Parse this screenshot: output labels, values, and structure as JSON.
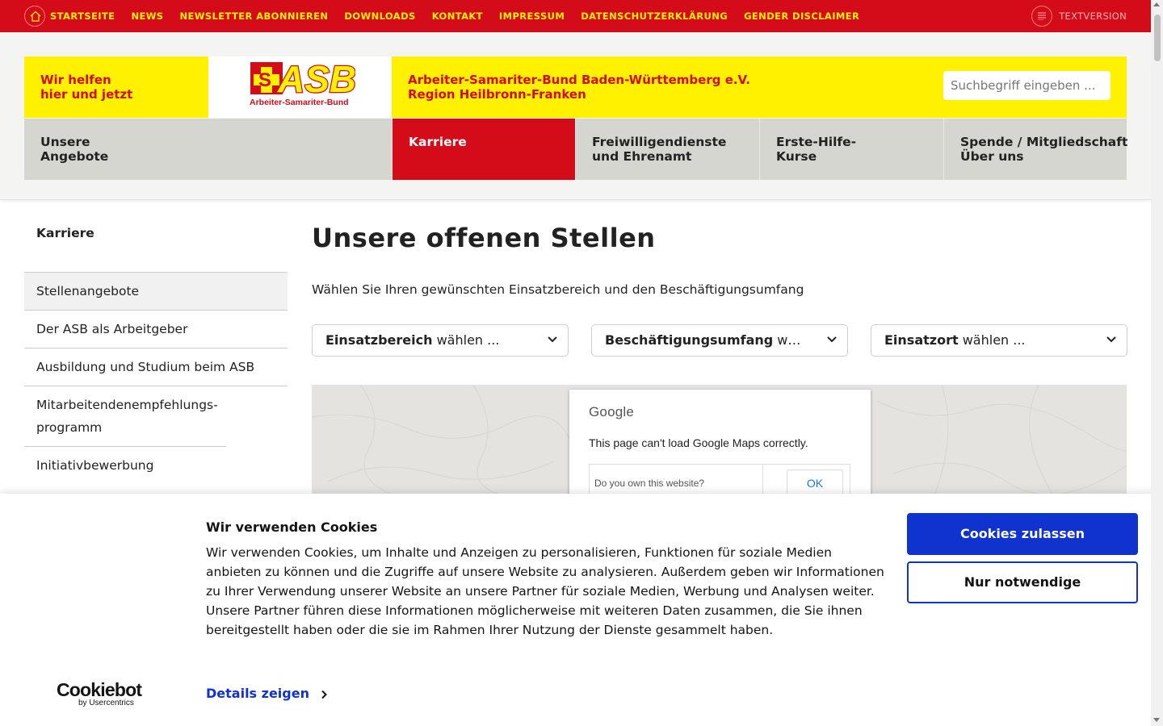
{
  "topnav": {
    "items": [
      {
        "label": "STARTSEITE"
      },
      {
        "label": "NEWS"
      },
      {
        "label": "NEWSLETTER ABONNIEREN"
      },
      {
        "label": "DOWNLOADS"
      },
      {
        "label": "KONTAKT"
      },
      {
        "label": "IMPRESSUM"
      },
      {
        "label": "DATENSCHUTZERKLÄRUNG"
      },
      {
        "label": "GENDER DISCLAIMER"
      }
    ],
    "textversion_label": "TEXTVERSION"
  },
  "header": {
    "slogan_line1": "Wir helfen",
    "slogan_line2": "hier und jetzt",
    "logo_text": "ASB",
    "logo_subtext": "Arbeiter-Samariter-Bund",
    "org_line1": "Arbeiter-Samariter-Bund Baden-Württemberg e.V.",
    "org_line2": "Region Heilbronn-Franken",
    "search_placeholder": "Suchbegriff eingeben ..."
  },
  "mainnav": {
    "items": [
      {
        "line1": "Unsere",
        "line2": "Angebote",
        "active": false
      },
      {
        "line1": "Karriere",
        "line2": "",
        "active": true
      },
      {
        "line1": "Freiwilligendienste",
        "line2": "und Ehrenamt",
        "active": false
      },
      {
        "line1": "Erste-Hilfe-",
        "line2": "Kurse",
        "active": false
      },
      {
        "line1": "Spende / Mitgliedschaft",
        "line2": "Über uns",
        "active": false
      }
    ]
  },
  "sidebar": {
    "title": "Karriere",
    "items": [
      {
        "label": "Stellenangebote",
        "active": true
      },
      {
        "label": "Der ASB als Arbeitgeber",
        "active": false
      },
      {
        "label": "Ausbildung und Studium beim ASB",
        "active": false
      },
      {
        "label": "Mitarbeitendenempfehlungs-programm",
        "active": false
      },
      {
        "label": "Initiativbewerbung",
        "active": false
      }
    ]
  },
  "main": {
    "title": "Unsere offenen Stellen",
    "intro": "Wählen Sie Ihren gewünschten Einsatzbereich und den Beschäftigungsumfang",
    "filters": [
      {
        "bold": "Einsatzbereich",
        "rest": " wählen ..."
      },
      {
        "bold": "Beschäftigungsumfang",
        "rest": " wählen ..."
      },
      {
        "bold": "Einsatzort",
        "rest": " wählen ..."
      }
    ],
    "map": {
      "google_label": "Google",
      "message": "This page can't load Google Maps correctly.",
      "own_question": "Do you own this website?",
      "ok_label": "OK"
    }
  },
  "cookie": {
    "title": "Wir verwenden Cookies",
    "text": "Wir verwenden Cookies, um Inhalte und Anzeigen zu personalisieren, Funktionen für soziale Medien anbieten zu können und die Zugriffe auf unsere Website zu analysieren. Außerdem geben wir Informationen zu Ihrer Verwendung unserer Website an unsere Partner für soziale Medien, Werbung und Analysen weiter. Unsere Partner führen diese Informationen möglicherweise mit weiteren Daten zusammen, die Sie ihnen bereitgestellt haben oder die sie im Rahmen Ihrer Nutzung der Dienste gesammelt haben.",
    "details_label": "Details zeigen",
    "allow_label": "Cookies zulassen",
    "necessary_label": "Nur notwendige",
    "brand_name": "Cookiebot",
    "brand_sub": "by Usercentrics"
  },
  "colors": {
    "brand_red": "#d40c19",
    "brand_yellow": "#fff100",
    "nav_gray": "#d6d6d0",
    "cookie_blue": "#1032cf"
  },
  "icons": {
    "home": "home-icon",
    "textversion": "list-lines-icon",
    "filter_chevron": "chevron-down-icon",
    "details_chevron": "chevron-right-icon"
  }
}
